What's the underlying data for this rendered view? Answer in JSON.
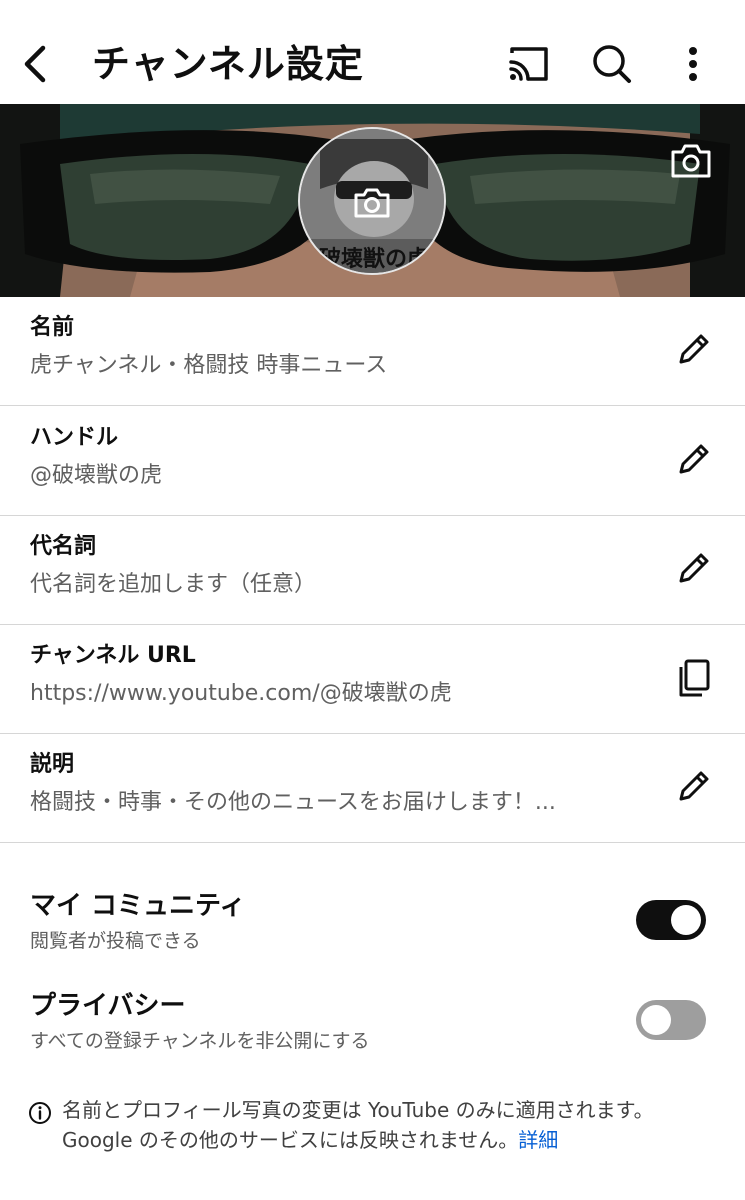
{
  "header": {
    "title": "チャンネル設定",
    "back_icon": "chevron-left-icon",
    "cast_icon": "cast-icon",
    "search_icon": "search-icon",
    "more_icon": "more-vertical-icon"
  },
  "banner": {
    "avatar_text": "破壊獣の虎",
    "camera_icon": "camera-icon"
  },
  "fields": [
    {
      "label": "名前",
      "value": "虎チャンネル・格闘技 時事ニュース",
      "action_icon": "pencil-icon"
    },
    {
      "label": "ハンドル",
      "value": "@破壊獣の虎",
      "action_icon": "pencil-icon"
    },
    {
      "label": "代名詞",
      "value": "代名詞を追加します（任意）",
      "action_icon": "pencil-icon"
    },
    {
      "label": "チャンネル URL",
      "value": "https://www.youtube.com/@破壊獣の虎",
      "action_icon": "copy-icon"
    },
    {
      "label": "説明",
      "value": "格闘技・時事・その他のニュースをお届けします！...",
      "action_icon": "pencil-icon"
    }
  ],
  "toggles": [
    {
      "title": "マイ コミュニティ",
      "subtitle": "閲覧者が投稿できる",
      "state": "on"
    },
    {
      "title": "プライバシー",
      "subtitle": "すべての登録チャンネルを非公開にする",
      "state": "off"
    }
  ],
  "footer": {
    "info_icon": "info-icon",
    "line1": "名前とプロフィール写真の変更は YouTube のみに適用されます。",
    "line2": "Google のその他のサービスには反映されません。",
    "link": "詳細"
  },
  "colors": {
    "link": "#065fd4",
    "toggle_on": "#0f0f0f",
    "toggle_off": "#9e9e9e",
    "secondary_text": "#606060"
  }
}
